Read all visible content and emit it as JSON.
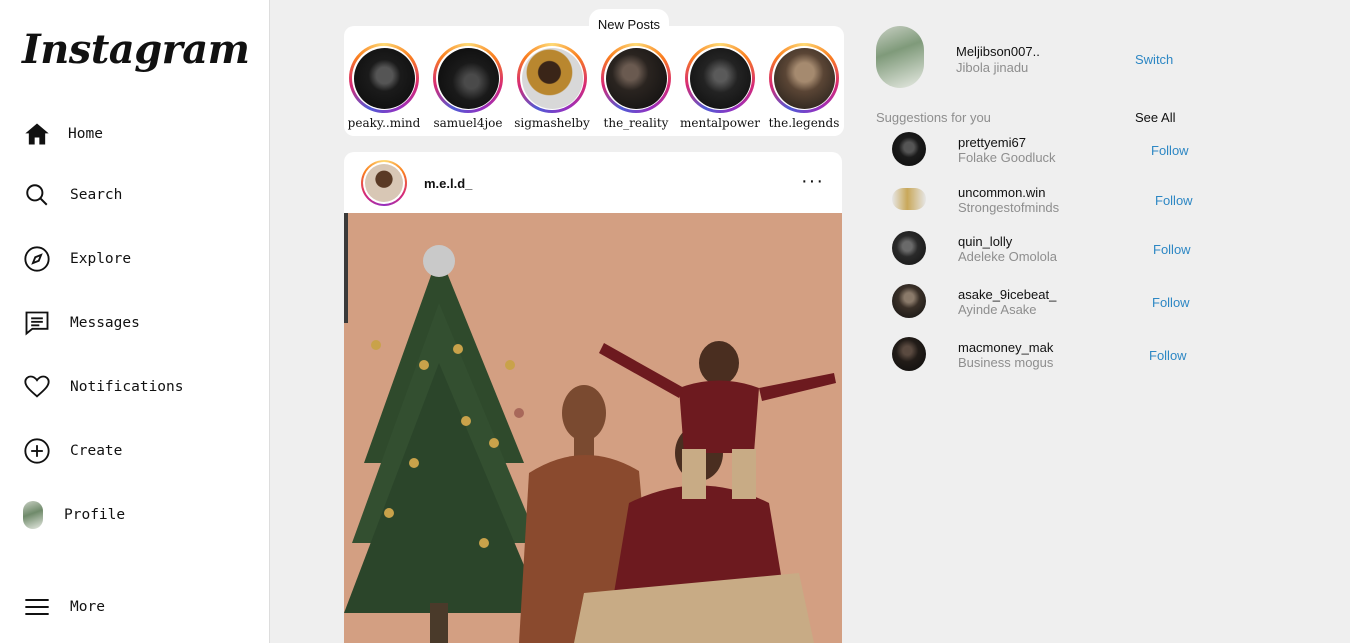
{
  "app": {
    "logo": "Instagram"
  },
  "nav": {
    "home": "Home",
    "search": "Search",
    "explore": "Explore",
    "messages": "Messages",
    "notifications": "Notifications",
    "create": "Create",
    "profile": "Profile",
    "more": "More"
  },
  "feed": {
    "new_posts": "New Posts",
    "stories": [
      {
        "name": "peaky..mind",
        "icon": "dark-portrait"
      },
      {
        "name": "samuel4joe",
        "icon": "dark-portrait"
      },
      {
        "name": "sigmashelby",
        "icon": "person-photo"
      },
      {
        "name": "the_reality",
        "icon": "dark-portrait"
      },
      {
        "name": "mentalpower",
        "icon": "dark-portrait"
      },
      {
        "name": "the.legends",
        "icon": "bearded-portrait"
      }
    ],
    "post": {
      "username": "m.e.l.d_",
      "menu": "···"
    }
  },
  "account": {
    "username": "Meljibson007..",
    "name": "Jibola jinadu",
    "switch": "Switch"
  },
  "suggestions": {
    "title": "Suggestions for you",
    "see_all": "See All",
    "items": [
      {
        "username": "prettyemi67",
        "name": "Folake Goodluck",
        "action": "Follow"
      },
      {
        "username": "uncommon.win",
        "name": "Strongestofminds",
        "action": "Follow"
      },
      {
        "username": "quin_lolly",
        "name": "Adeleke Omolola",
        "action": "Follow"
      },
      {
        "username": "asake_9icebeat_",
        "name": "Ayinde Asake",
        "action": "Follow"
      },
      {
        "username": "macmoney_mak",
        "name": "Business mogus",
        "action": "Follow"
      }
    ]
  },
  "colors": {
    "link": "#2d87c4",
    "muted": "#8e8e8e",
    "background": "#efefef"
  }
}
